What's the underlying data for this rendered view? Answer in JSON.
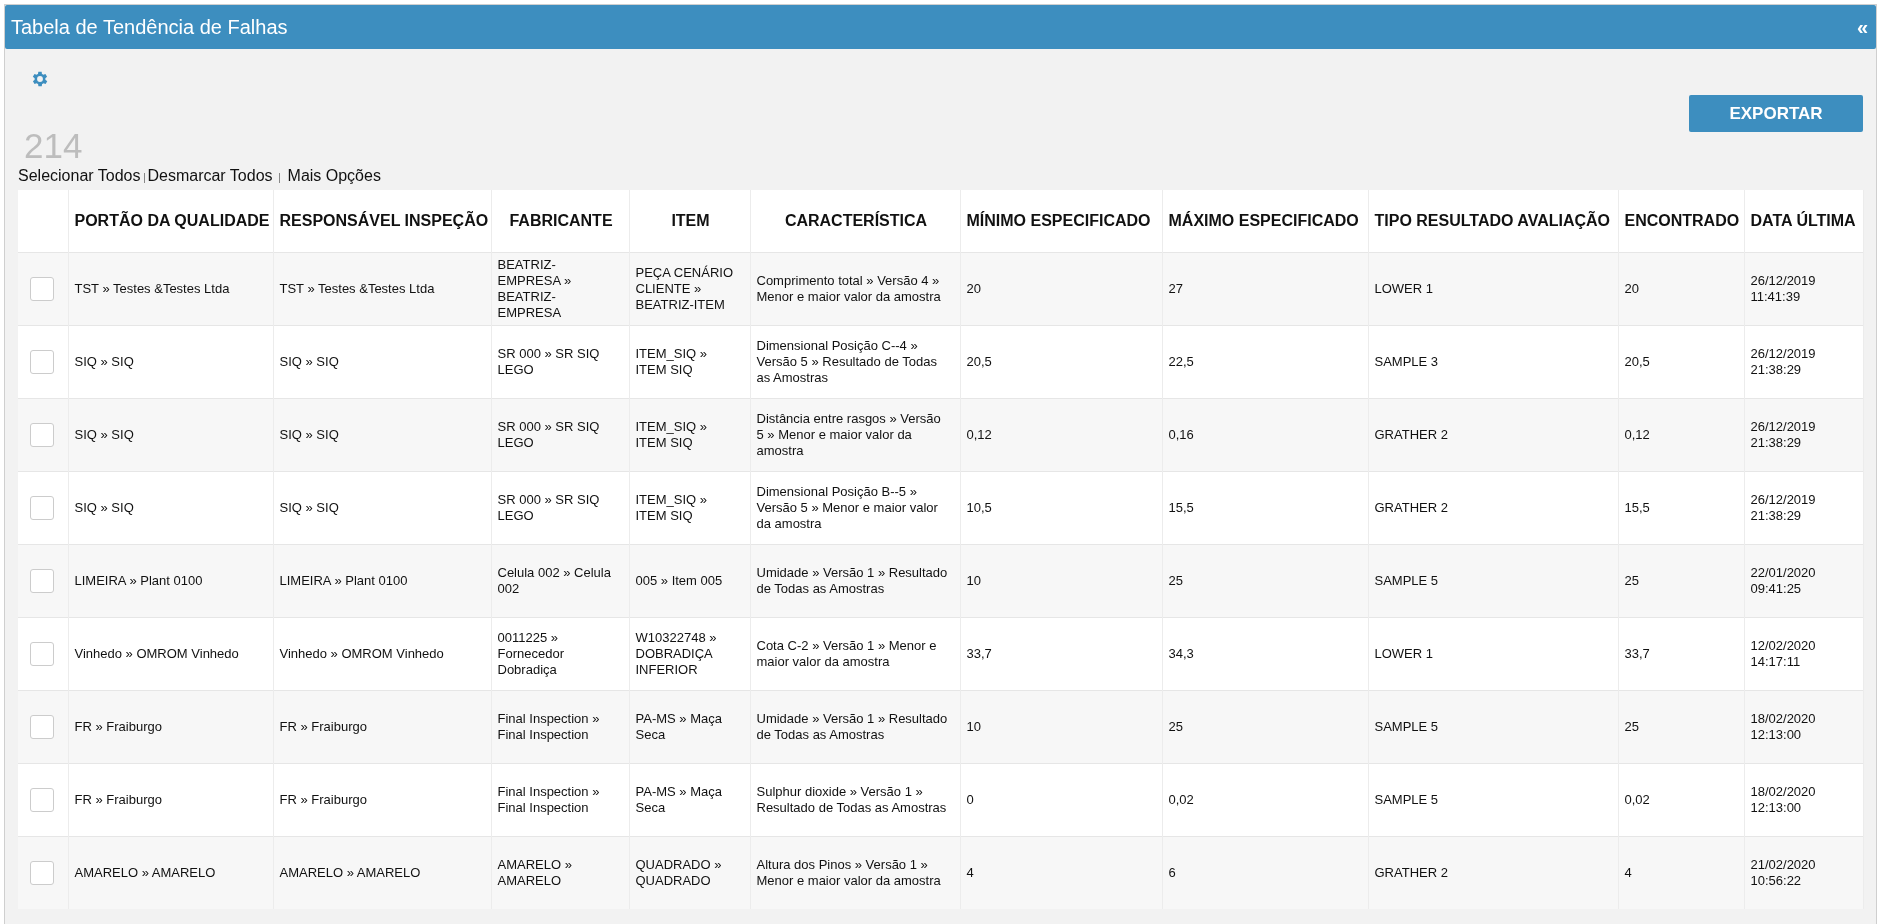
{
  "panel": {
    "title": "Tabela de Tendência de Falhas",
    "collapse_icon": "«"
  },
  "toolbar": {
    "export_button": "EXPORTAR"
  },
  "count": "214",
  "actions": [
    {
      "label": "Selecionar Todos"
    },
    {
      "label": "Desmarcar Todos"
    },
    {
      "label": "Mais Opções"
    }
  ],
  "table": {
    "columns": [
      "PORTÃO DA QUALIDADE",
      "RESPONSÁVEL INSPEÇÃO",
      "FABRICANTE",
      "ITEM",
      "CARACTERÍSTICA",
      "MÍNIMO ESPECIFICADO",
      "MÁXIMO ESPECIFICADO",
      "TIPO RESULTADO AVALIAÇÃO",
      "ENCONTRADO",
      "DATA ÚLTIMA"
    ],
    "rows": [
      {
        "checked": false,
        "cells": [
          "TST » Testes &Testes Ltda",
          "TST » Testes &Testes Ltda",
          "BEATRIZ-EMPRESA » BEATRIZ-EMPRESA",
          "PEÇA CENÁRIO CLIENTE » BEATRIZ-ITEM",
          "Comprimento total » Versão 4 » Menor e maior valor da amostra",
          "20",
          "27",
          "LOWER 1",
          "20",
          "26/12/2019 11:41:39"
        ]
      },
      {
        "checked": false,
        "cells": [
          "SIQ » SIQ",
          "SIQ » SIQ",
          "SR 000 » SR SIQ LEGO",
          "ITEM_SIQ » ITEM SIQ",
          "Dimensional Posição C--4 » Versão 5 » Resultado de Todas as Amostras",
          "20,5",
          "22,5",
          "SAMPLE 3",
          "20,5",
          "26/12/2019 21:38:29"
        ]
      },
      {
        "checked": false,
        "cells": [
          "SIQ » SIQ",
          "SIQ » SIQ",
          "SR 000 » SR SIQ LEGO",
          "ITEM_SIQ » ITEM SIQ",
          "Distância entre rasgos » Versão 5 » Menor e maior valor da amostra",
          "0,12",
          "0,16",
          "GRATHER 2",
          "0,12",
          "26/12/2019 21:38:29"
        ]
      },
      {
        "checked": false,
        "cells": [
          "SIQ » SIQ",
          "SIQ » SIQ",
          "SR 000 » SR SIQ LEGO",
          "ITEM_SIQ » ITEM SIQ",
          "Dimensional Posição B--5 » Versão 5 » Menor e maior valor da amostra",
          "10,5",
          "15,5",
          "GRATHER 2",
          "15,5",
          "26/12/2019 21:38:29"
        ]
      },
      {
        "checked": false,
        "cells": [
          "LIMEIRA » Plant 0100",
          "LIMEIRA » Plant 0100",
          "Celula 002 » Celula 002",
          "005 » Item 005",
          "Umidade » Versão 1 » Resultado de Todas as Amostras",
          "10",
          "25",
          "SAMPLE 5",
          "25",
          "22/01/2020 09:41:25"
        ]
      },
      {
        "checked": false,
        "cells": [
          "Vinhedo » OMROM Vinhedo",
          "Vinhedo » OMROM Vinhedo",
          "0011225 » Fornecedor Dobradiça",
          "W10322748 » DOBRADIÇA INFERIOR",
          "Cota C-2 » Versão 1 » Menor e maior valor da amostra",
          "33,7",
          "34,3",
          "LOWER 1",
          "33,7",
          "12/02/2020 14:17:11"
        ]
      },
      {
        "checked": false,
        "cells": [
          "FR » Fraiburgo",
          "FR » Fraiburgo",
          "Final Inspection » Final Inspection",
          "PA-MS » Maça Seca",
          "Umidade » Versão 1 » Resultado de Todas as Amostras",
          "10",
          "25",
          "SAMPLE 5",
          "25",
          "18/02/2020 12:13:00"
        ]
      },
      {
        "checked": false,
        "cells": [
          "FR » Fraiburgo",
          "FR » Fraiburgo",
          "Final Inspection » Final Inspection",
          "PA-MS » Maça Seca",
          "Sulphur dioxide » Versão 1 » Resultado de Todas as Amostras",
          "0",
          "0,02",
          "SAMPLE 5",
          "0,02",
          "18/02/2020 12:13:00"
        ]
      },
      {
        "checked": false,
        "cells": [
          "AMARELO » AMARELO",
          "AMARELO » AMARELO",
          "AMARELO » AMARELO",
          "QUADRADO » QUADRADO",
          "Altura dos Pinos » Versão 1 » Menor e maior valor da amostra",
          "4",
          "6",
          "GRATHER 2",
          "4",
          "21/02/2020 10:56:22"
        ]
      }
    ]
  }
}
